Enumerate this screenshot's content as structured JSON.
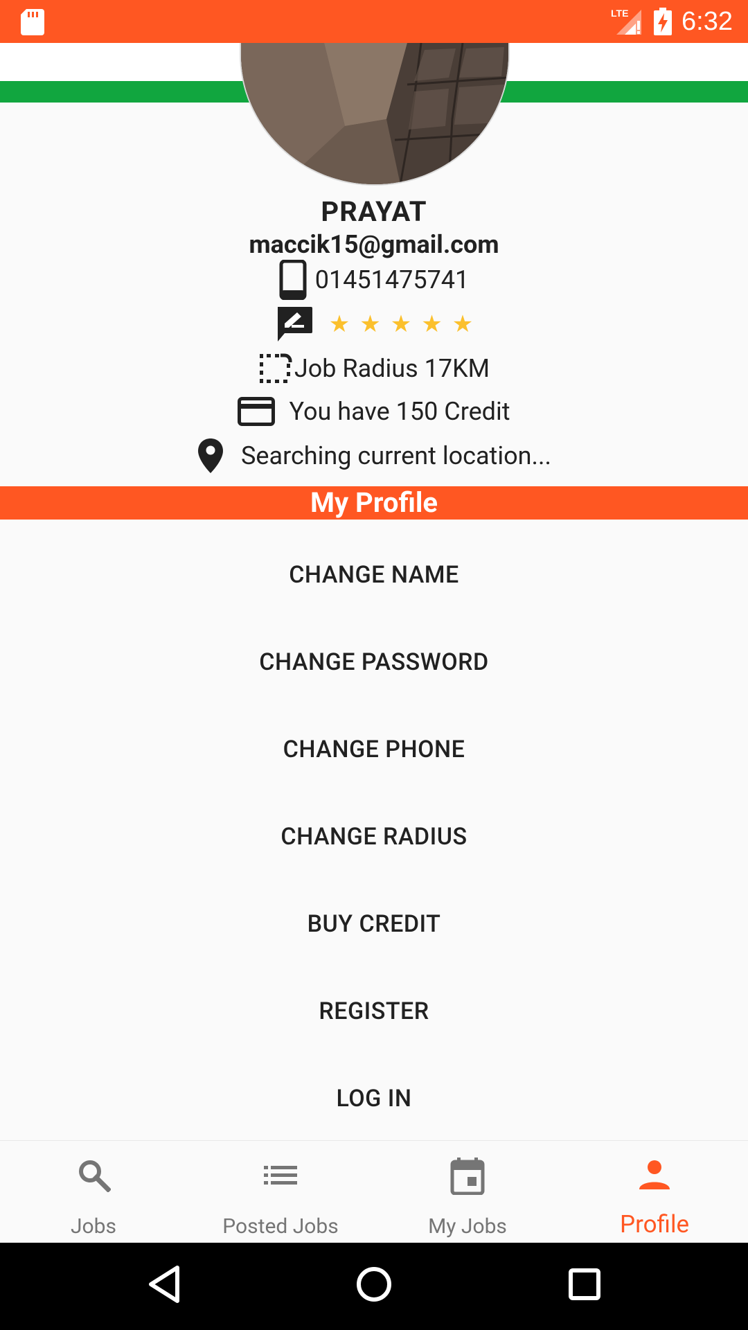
{
  "status_bar": {
    "time": "6:32",
    "network": "LTE",
    "colors": {
      "background": "#ff5722"
    },
    "icons": [
      "sd-card-icon",
      "signal-lte-icon",
      "battery-charging-icon"
    ]
  },
  "profile": {
    "name": "PRAYAT",
    "email": "maccik15@gmail.com",
    "phone": "01451475741",
    "rating": {
      "stars": 5,
      "max": 5
    },
    "job_radius": "Job Radius 17KM",
    "credit": "You have 150 Credit",
    "location": "Searching current location..."
  },
  "section_title": "My Profile",
  "menu": [
    {
      "label": "CHANGE NAME"
    },
    {
      "label": "CHANGE PASSWORD"
    },
    {
      "label": "CHANGE PHONE"
    },
    {
      "label": "CHANGE RADIUS"
    },
    {
      "label": "BUY CREDIT"
    },
    {
      "label": "REGISTER"
    },
    {
      "label": "LOG IN"
    }
  ],
  "bottom_nav": [
    {
      "label": "Jobs",
      "icon": "search-icon",
      "active": false
    },
    {
      "label": "Posted Jobs",
      "icon": "list-icon",
      "active": false
    },
    {
      "label": "My Jobs",
      "icon": "calendar-icon",
      "active": false
    },
    {
      "label": "Profile",
      "icon": "person-icon",
      "active": true
    }
  ],
  "colors": {
    "accent": "#ff5722",
    "flag_green": "#11a63f",
    "star": "#fbc02d",
    "text": "#212121",
    "inactive": "#757575"
  }
}
